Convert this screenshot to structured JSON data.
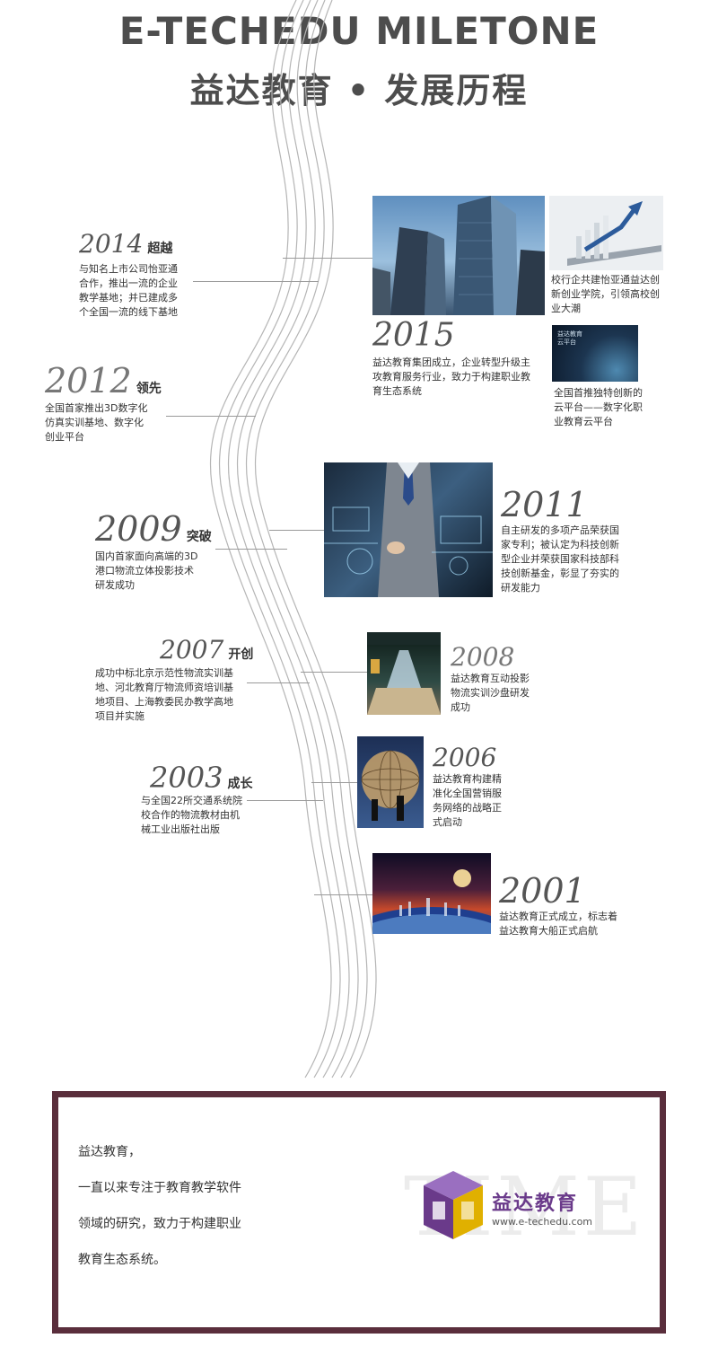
{
  "header": {
    "title_en": "E-TECHEDU  MILETONE",
    "title_cn": "益达教育 • 发展历程"
  },
  "milestones": {
    "y2014": {
      "year": "2014",
      "tag": "超越",
      "lines": [
        "与知名上市公司怡亚通",
        "合作，推出一流的企业",
        "教学基地；并已建成多",
        "个全国一流的线下基地"
      ]
    },
    "y2015": {
      "year": "2015",
      "lines": [
        "益达教育集团成立，企业转型升级主",
        "攻教育服务行业，致力于构建职业教",
        "育生态系统"
      ]
    },
    "y2015_school": {
      "lines": [
        "校行企共建怡亚通益达创",
        "新创业学院，引领高校创",
        "业大潮"
      ]
    },
    "y2015_cloud": {
      "lines": [
        "全国首推独特创新的",
        "云平台——数字化职",
        "业教育云平台"
      ],
      "img_caption": [
        "益达教育",
        "云平台"
      ]
    },
    "y2012": {
      "year": "2012",
      "tag": "领先",
      "lines": [
        "全国首家推出3D数字化",
        "仿真实训基地、数字化",
        "创业平台"
      ]
    },
    "y2011": {
      "year": "2011",
      "lines": [
        "自主研发的多项产品荣获国",
        "家专利；被认定为科技创新",
        "型企业并荣获国家科技部科",
        "技创新基金，彰显了夯实的",
        "研发能力"
      ]
    },
    "y2009": {
      "year": "2009",
      "tag": "突破",
      "lines": [
        "国内首家面向高端的3D",
        "港口物流立体投影技术",
        "研发成功"
      ]
    },
    "y2007": {
      "year": "2007",
      "tag": "开创",
      "lines": [
        "成功中标北京示范性物流实训基",
        "地、河北教育厅物流师资培训基",
        "地项目、上海教委民办教学高地",
        "项目并实施"
      ]
    },
    "y2008": {
      "year": "2008",
      "lines": [
        "益达教育互动投影",
        "物流实训沙盘研发",
        "成功"
      ]
    },
    "y2006": {
      "year": "2006",
      "lines": [
        "益达教育构建精",
        "准化全国营销服",
        "务网络的战略正",
        "式启动"
      ]
    },
    "y2003": {
      "year": "2003",
      "tag": "成长",
      "lines": [
        "与全国22所交通系统院",
        "校合作的物流教材由机",
        "械工业出版社出版"
      ]
    },
    "y2001": {
      "year": "2001",
      "lines": [
        "益达教育正式成立，标志着",
        "益达教育大船正式启航"
      ]
    }
  },
  "summary": {
    "lines": [
      "益达教育，",
      "一直以来专注于教育教学软件",
      "领域的研究，致力于构建职业",
      "教育生态系统。"
    ],
    "watermark": "TIME",
    "brand_name": "益达教育",
    "brand_url": "www.e-techedu.com"
  },
  "colors": {
    "summary_border": "#5a2e3c",
    "brand_purple": "#6a3a8a",
    "line_gray": "#9a9a9a"
  }
}
